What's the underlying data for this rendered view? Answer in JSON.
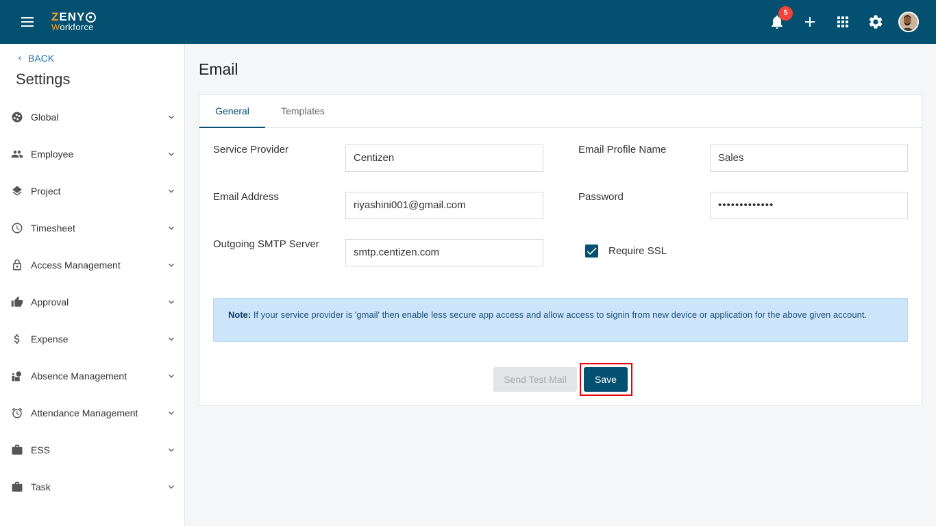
{
  "header": {
    "logo_line1_z": "Z",
    "logo_line1_rest": "ENY",
    "logo_line2_w": "W",
    "logo_line2_rest": "orkforce",
    "notification_count": "5",
    "icons": [
      "menu-icon",
      "bell-icon",
      "plus-icon",
      "apps-grid-icon",
      "gear-icon",
      "user-avatar"
    ],
    "brand_color": "#035071",
    "badge_color": "#f44336"
  },
  "sidebar": {
    "back_label": "BACK",
    "title": "Settings",
    "items": [
      {
        "label": "Global",
        "icon": "globe-icon"
      },
      {
        "label": "Employee",
        "icon": "people-icon"
      },
      {
        "label": "Project",
        "icon": "layers-icon"
      },
      {
        "label": "Timesheet",
        "icon": "clock-icon"
      },
      {
        "label": "Access Management",
        "icon": "lock-icon"
      },
      {
        "label": "Approval",
        "icon": "thumbs-up-icon"
      },
      {
        "label": "Expense",
        "icon": "dollar-icon"
      },
      {
        "label": "Absence Management",
        "icon": "absence-icon"
      },
      {
        "label": "Attendance Management",
        "icon": "alarm-icon"
      },
      {
        "label": "ESS",
        "icon": "briefcase-icon"
      },
      {
        "label": "Task",
        "icon": "briefcase-icon"
      }
    ]
  },
  "main": {
    "title": "Email",
    "tabs": [
      {
        "label": "General",
        "active": true
      },
      {
        "label": "Templates",
        "active": false
      }
    ],
    "form": {
      "service_provider_label": "Service Provider",
      "service_provider_value": "Centizen",
      "email_profile_name_label": "Email Profile Name",
      "email_profile_name_value": "Sales",
      "email_address_label": "Email Address",
      "email_address_value": "riyashini001@gmail.com",
      "password_label": "Password",
      "password_value": "•••••••••••••",
      "smtp_label": "Outgoing SMTP Server",
      "smtp_value": "smtp.centizen.com",
      "require_ssl_label": "Require SSL",
      "require_ssl_checked": true
    },
    "note": {
      "prefix": "Note:",
      "text": " If your service provider is 'gmail' then enable less secure app access and allow access to signin from new device or application for the above given account."
    },
    "buttons": {
      "send_test_mail": "Send Test Mail",
      "save": "Save"
    },
    "highlight_color": "#e8000b"
  }
}
